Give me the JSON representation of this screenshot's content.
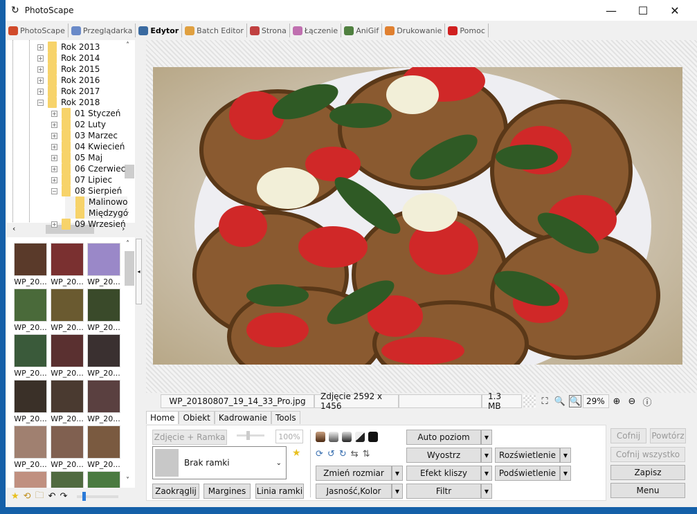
{
  "app": {
    "title": "PhotoScape"
  },
  "window_controls": {
    "minimize": "—",
    "maximize": "☐",
    "close": "✕"
  },
  "tabs": [
    {
      "label": "PhotoScape",
      "color": "#d04a2a"
    },
    {
      "label": "Przeglądarka",
      "color": "#6a8ac8"
    },
    {
      "label": "Edytor",
      "color": "#3a6aa0",
      "active": true
    },
    {
      "label": "Batch Editor",
      "color": "#e0a040"
    },
    {
      "label": "Strona",
      "color": "#c04040"
    },
    {
      "label": "Łączenie",
      "color": "#c070b0"
    },
    {
      "label": "AniGif",
      "color": "#508040"
    },
    {
      "label": "Drukowanie",
      "color": "#e08030"
    },
    {
      "label": "Pomoc",
      "color": "#d02020"
    }
  ],
  "tree": [
    {
      "label": "Rok 2013",
      "level": 0,
      "expander": "+"
    },
    {
      "label": "Rok 2014",
      "level": 0,
      "expander": "+"
    },
    {
      "label": "Rok 2015",
      "level": 0,
      "expander": "+"
    },
    {
      "label": "Rok 2016",
      "level": 0,
      "expander": "+"
    },
    {
      "label": "Rok 2017",
      "level": 0,
      "expander": "+"
    },
    {
      "label": "Rok 2018",
      "level": 0,
      "expander": "−"
    },
    {
      "label": "01 Styczeń",
      "level": 1,
      "expander": "+"
    },
    {
      "label": "02 Luty",
      "level": 1,
      "expander": "+"
    },
    {
      "label": "03 Marzec",
      "level": 1,
      "expander": "+"
    },
    {
      "label": "04 Kwiecień",
      "level": 1,
      "expander": "+"
    },
    {
      "label": "05 Maj",
      "level": 1,
      "expander": "+"
    },
    {
      "label": "06 Czerwiec",
      "level": 1,
      "expander": "+"
    },
    {
      "label": "07 Lipiec",
      "level": 1,
      "expander": "+"
    },
    {
      "label": "08 Sierpień",
      "level": 1,
      "expander": "−"
    },
    {
      "label": "Malinowo",
      "level": 2,
      "expander": ""
    },
    {
      "label": "Międzygó",
      "level": 2,
      "expander": ""
    },
    {
      "label": "09 Wrzesień",
      "level": 1,
      "expander": "+"
    }
  ],
  "thumbnails": [
    {
      "label": "WP_20...",
      "color": "#5a3a2a"
    },
    {
      "label": "WP_20...",
      "color": "#7a3030"
    },
    {
      "label": "WP_20...",
      "color": "#9a88c8"
    },
    {
      "label": "WP_20...",
      "color": "#4a6a3a"
    },
    {
      "label": "WP_20...",
      "color": "#6a5a30"
    },
    {
      "label": "WP_20...",
      "color": "#3a4a2a"
    },
    {
      "label": "WP_20...",
      "color": "#3a5a3a"
    },
    {
      "label": "WP_20...",
      "color": "#5a3030"
    },
    {
      "label": "WP_20...",
      "color": "#3a3030"
    },
    {
      "label": "WP_20...",
      "color": "#3a3028"
    },
    {
      "label": "WP_20...",
      "color": "#4a3a30"
    },
    {
      "label": "WP_20...",
      "color": "#5a4040"
    },
    {
      "label": "WP_20...",
      "color": "#a08070"
    },
    {
      "label": "WP_20...",
      "color": "#806050"
    },
    {
      "label": "WP_20...",
      "color": "#7a5a40"
    },
    {
      "label": "",
      "color": "#c09080"
    },
    {
      "label": "",
      "color": "#506a40"
    },
    {
      "label": "",
      "color": "#4a7a40"
    }
  ],
  "status": {
    "filename": "WP_20180807_19_14_33_Pro.jpg",
    "dimensions": "Zdjęcie 2592 x 1456",
    "empty": "",
    "size": "1.3 MB",
    "zoom": "29%"
  },
  "editor_tabs": [
    "Home",
    "Obiekt",
    "Kadrowanie",
    "Tools"
  ],
  "home": {
    "photo_frame": "Zdjęcie + Ramka",
    "opacity": "100%",
    "frame_select": "Brak ramki",
    "round": "Zaokrąglij",
    "margins": "Margines",
    "frame_line": "Linia ramki",
    "auto_level": "Auto poziom",
    "sharpen": "Wyostrz",
    "resize": "Zmień rozmiar",
    "film_effect": "Efekt kliszy",
    "brightness_color": "Jasność,Kolor",
    "filter": "Filtr",
    "backlight": "Rozświetlenie",
    "fill_light": "Podświetlenie"
  },
  "actions": {
    "undo": "Cofnij",
    "redo": "Powtórz",
    "undo_all": "Cofnij wszystko",
    "save": "Zapisz",
    "menu": "Menu"
  }
}
